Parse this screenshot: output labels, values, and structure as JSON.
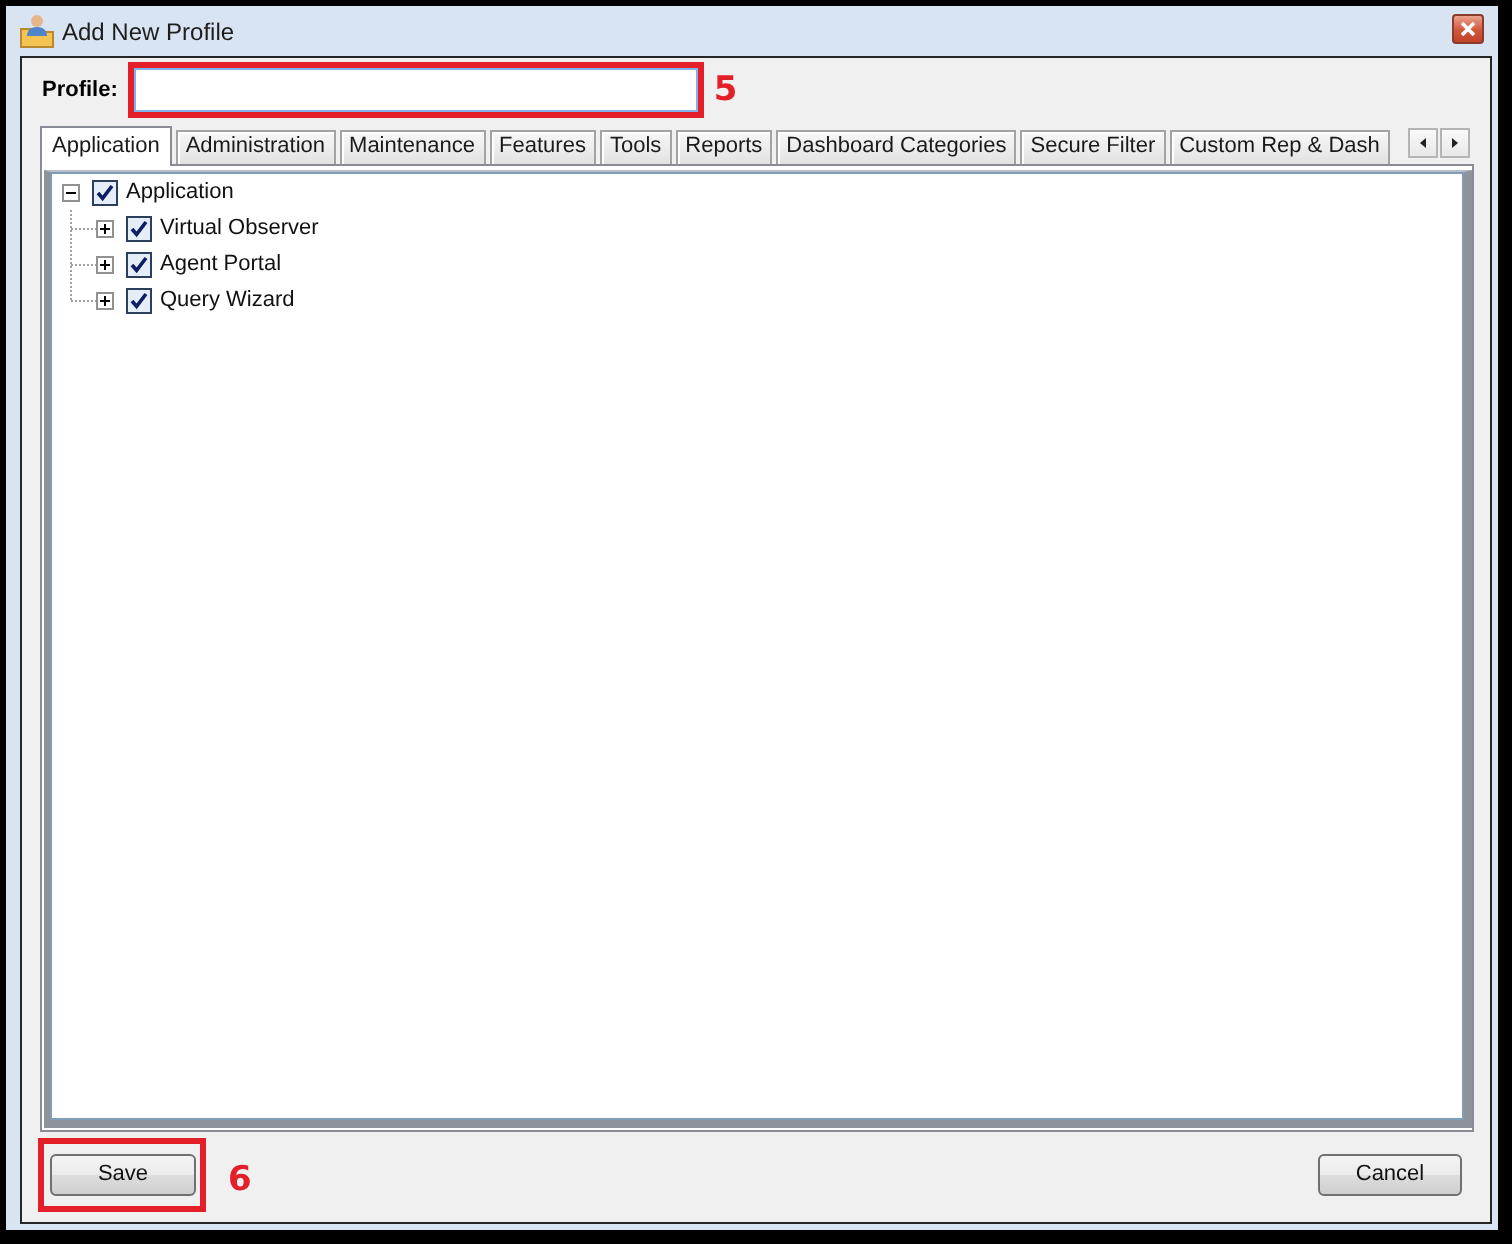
{
  "window": {
    "title": "Add New Profile"
  },
  "profile": {
    "label": "Profile:",
    "callout": "5"
  },
  "tabs": [
    {
      "label": "Application",
      "selected": true
    },
    {
      "label": "Administration",
      "selected": false
    },
    {
      "label": "Maintenance",
      "selected": false
    },
    {
      "label": "Features",
      "selected": false
    },
    {
      "label": "Tools",
      "selected": false
    },
    {
      "label": "Reports",
      "selected": false
    },
    {
      "label": "Dashboard Categories",
      "selected": false
    },
    {
      "label": "Secure Filter",
      "selected": false
    },
    {
      "label": "Custom Rep & Dash",
      "selected": false
    }
  ],
  "tree": [
    {
      "label": "Application",
      "checked": true,
      "expanded": true,
      "children": [
        {
          "label": "Virtual Observer",
          "checked": true,
          "expanded": false
        },
        {
          "label": "Agent Portal",
          "checked": true,
          "expanded": false
        },
        {
          "label": "Query Wizard",
          "checked": true,
          "expanded": false
        }
      ]
    }
  ],
  "buttons": [
    {
      "label": "Save",
      "callout": "6"
    },
    {
      "label": "Cancel"
    }
  ]
}
